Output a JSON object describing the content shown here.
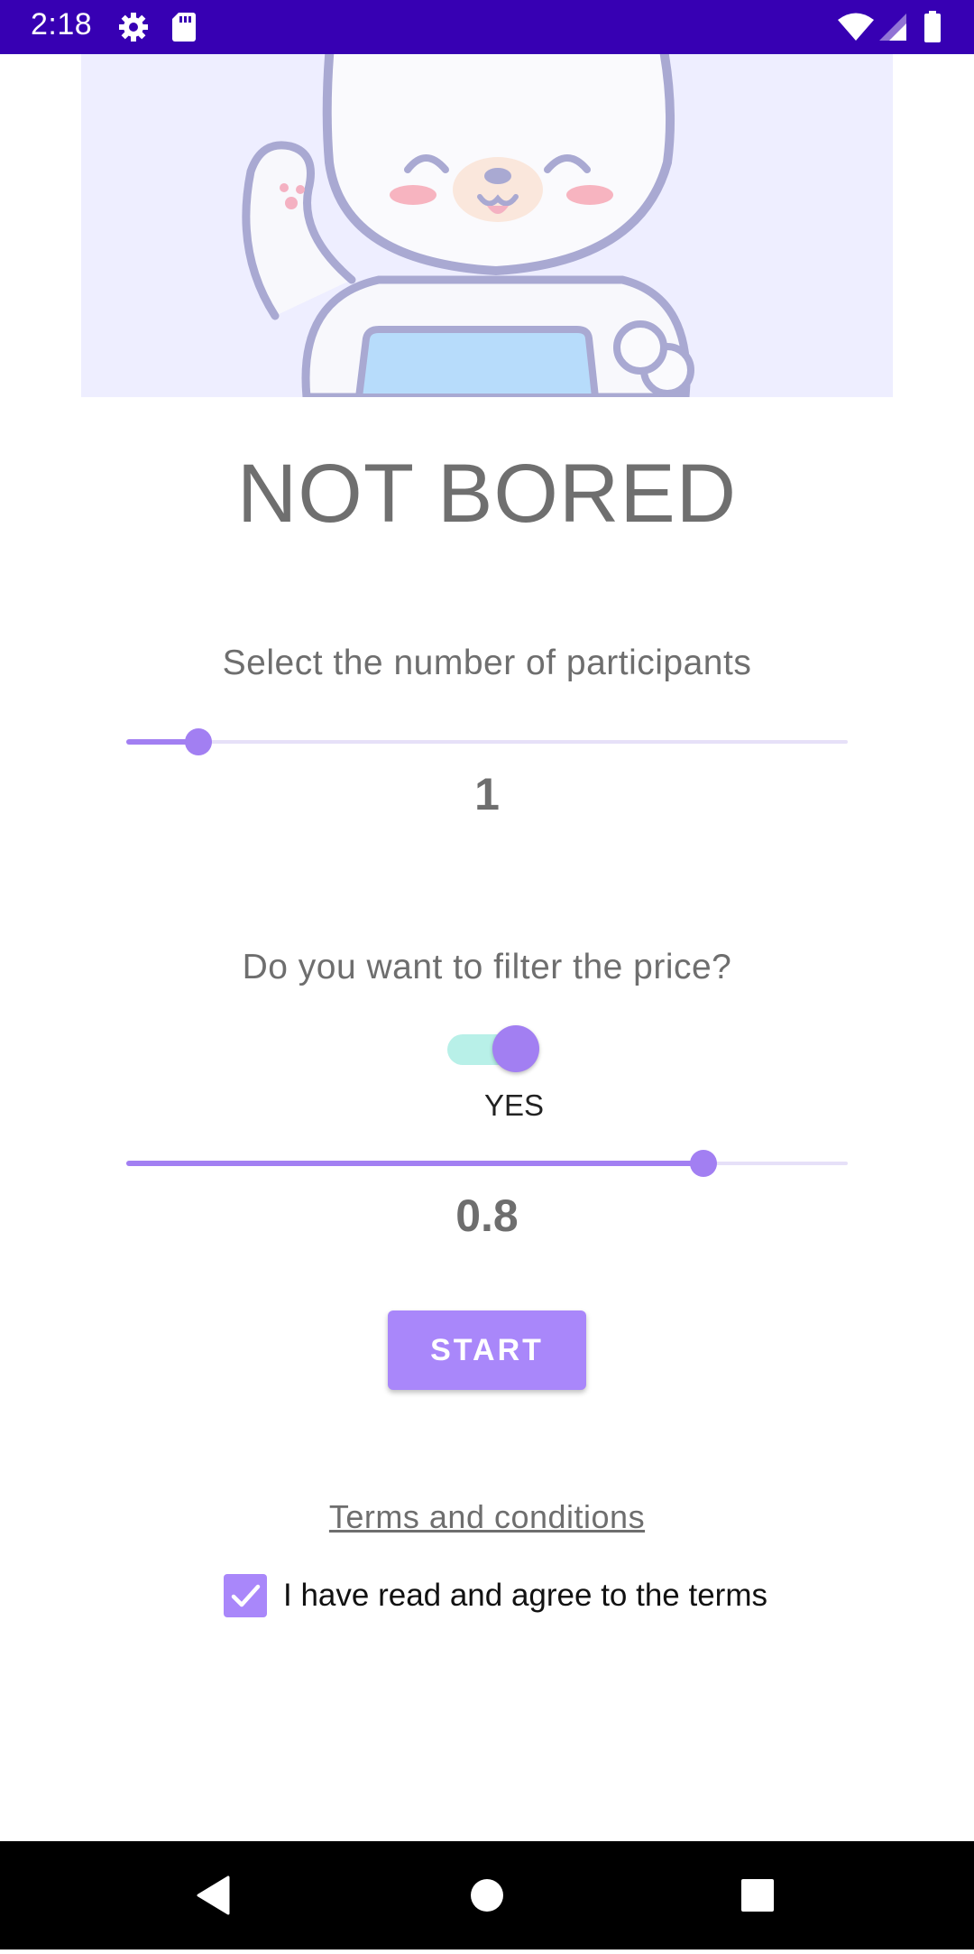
{
  "status_bar": {
    "time": "2:18",
    "icons": [
      "settings-icon",
      "sd-card-icon",
      "wifi-icon",
      "cell-signal-icon",
      "battery-icon"
    ]
  },
  "hero": {
    "image": "waving-bear-illustration"
  },
  "app": {
    "title": "NOT BORED"
  },
  "participants": {
    "label": "Select the number of participants",
    "value": "1",
    "slider_fraction": 0.1
  },
  "price_filter": {
    "question": "Do you want to filter the price?",
    "switch_on": true,
    "switch_label": "YES",
    "value": "0.8",
    "slider_fraction": 0.8
  },
  "start_button": {
    "label": "START"
  },
  "terms": {
    "link_label": "Terms and conditions",
    "agree_label": "I have read and agree to the terms",
    "agreed": true
  },
  "colors": {
    "status_bar": "#3700b3",
    "accent": "#a27ff2",
    "button": "#a987fa",
    "switch_track": "#b8f0e8",
    "hero_background": "#eeeeff"
  },
  "nav_bar": {
    "buttons": [
      "back-icon",
      "home-icon",
      "recents-icon"
    ]
  }
}
